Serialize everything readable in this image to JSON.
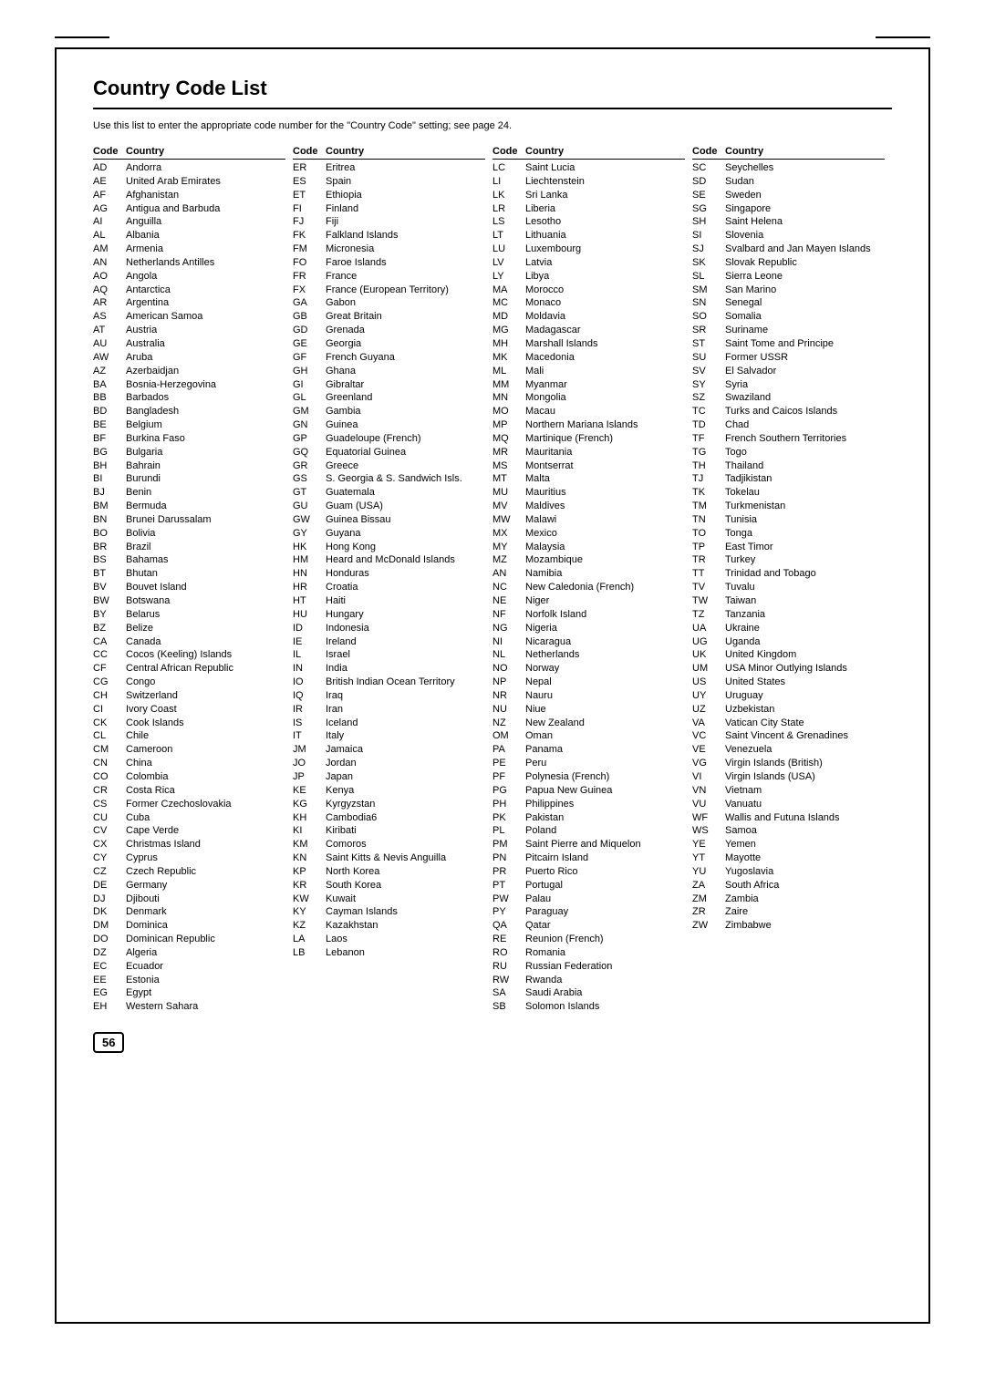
{
  "page": {
    "title": "Country Code List",
    "subtitle": "Use this list to enter the appropriate code number for the \"Country Code\" setting; see page 24.",
    "page_number": "56"
  },
  "columns": [
    {
      "header": {
        "code": "Code",
        "country": "Country"
      },
      "entries": [
        {
          "code": "AD",
          "country": "Andorra"
        },
        {
          "code": "AE",
          "country": "United Arab Emirates"
        },
        {
          "code": "AF",
          "country": "Afghanistan"
        },
        {
          "code": "AG",
          "country": "Antigua and Barbuda"
        },
        {
          "code": "AI",
          "country": "Anguilla"
        },
        {
          "code": "AL",
          "country": "Albania"
        },
        {
          "code": "AM",
          "country": "Armenia"
        },
        {
          "code": "AN",
          "country": "Netherlands Antilles"
        },
        {
          "code": "AO",
          "country": "Angola"
        },
        {
          "code": "AQ",
          "country": "Antarctica"
        },
        {
          "code": "AR",
          "country": "Argentina"
        },
        {
          "code": "AS",
          "country": "American Samoa"
        },
        {
          "code": "AT",
          "country": "Austria"
        },
        {
          "code": "AU",
          "country": "Australia"
        },
        {
          "code": "AW",
          "country": "Aruba"
        },
        {
          "code": "AZ",
          "country": "Azerbaidjan"
        },
        {
          "code": "BA",
          "country": "Bosnia-Herzegovina"
        },
        {
          "code": "BB",
          "country": "Barbados"
        },
        {
          "code": "BD",
          "country": "Bangladesh"
        },
        {
          "code": "BE",
          "country": "Belgium"
        },
        {
          "code": "BF",
          "country": "Burkina Faso"
        },
        {
          "code": "BG",
          "country": "Bulgaria"
        },
        {
          "code": "BH",
          "country": "Bahrain"
        },
        {
          "code": "BI",
          "country": "Burundi"
        },
        {
          "code": "BJ",
          "country": "Benin"
        },
        {
          "code": "BM",
          "country": "Bermuda"
        },
        {
          "code": "BN",
          "country": "Brunei Darussalam"
        },
        {
          "code": "BO",
          "country": "Bolivia"
        },
        {
          "code": "BR",
          "country": "Brazil"
        },
        {
          "code": "BS",
          "country": "Bahamas"
        },
        {
          "code": "BT",
          "country": "Bhutan"
        },
        {
          "code": "BV",
          "country": "Bouvet Island"
        },
        {
          "code": "BW",
          "country": "Botswana"
        },
        {
          "code": "BY",
          "country": "Belarus"
        },
        {
          "code": "BZ",
          "country": "Belize"
        },
        {
          "code": "CA",
          "country": "Canada"
        },
        {
          "code": "CC",
          "country": "Cocos (Keeling) Islands"
        },
        {
          "code": "CF",
          "country": "Central African Republic"
        },
        {
          "code": "CG",
          "country": "Congo"
        },
        {
          "code": "CH",
          "country": "Switzerland"
        },
        {
          "code": "CI",
          "country": "Ivory Coast"
        },
        {
          "code": "CK",
          "country": "Cook Islands"
        },
        {
          "code": "CL",
          "country": "Chile"
        },
        {
          "code": "CM",
          "country": "Cameroon"
        },
        {
          "code": "CN",
          "country": "China"
        },
        {
          "code": "CO",
          "country": "Colombia"
        },
        {
          "code": "CR",
          "country": "Costa Rica"
        },
        {
          "code": "CS",
          "country": "Former Czechoslovakia"
        },
        {
          "code": "CU",
          "country": "Cuba"
        },
        {
          "code": "CV",
          "country": "Cape Verde"
        },
        {
          "code": "CX",
          "country": "Christmas Island"
        },
        {
          "code": "CY",
          "country": "Cyprus"
        },
        {
          "code": "CZ",
          "country": "Czech Republic"
        },
        {
          "code": "DE",
          "country": "Germany"
        },
        {
          "code": "DJ",
          "country": "Djibouti"
        },
        {
          "code": "DK",
          "country": "Denmark"
        },
        {
          "code": "DM",
          "country": "Dominica"
        },
        {
          "code": "DO",
          "country": "Dominican Republic"
        },
        {
          "code": "DZ",
          "country": "Algeria"
        },
        {
          "code": "EC",
          "country": "Ecuador"
        },
        {
          "code": "EE",
          "country": "Estonia"
        },
        {
          "code": "EG",
          "country": "Egypt"
        },
        {
          "code": "EH",
          "country": "Western Sahara"
        }
      ]
    },
    {
      "header": {
        "code": "Code",
        "country": "Country"
      },
      "entries": [
        {
          "code": "ER",
          "country": "Eritrea"
        },
        {
          "code": "ES",
          "country": "Spain"
        },
        {
          "code": "ET",
          "country": "Ethiopia"
        },
        {
          "code": "FI",
          "country": "Finland"
        },
        {
          "code": "FJ",
          "country": "Fiji"
        },
        {
          "code": "FK",
          "country": "Falkland Islands"
        },
        {
          "code": "FM",
          "country": "Micronesia"
        },
        {
          "code": "FO",
          "country": "Faroe Islands"
        },
        {
          "code": "FR",
          "country": "France"
        },
        {
          "code": "FX",
          "country": "France (European Territory)"
        },
        {
          "code": "GA",
          "country": "Gabon"
        },
        {
          "code": "GB",
          "country": "Great Britain"
        },
        {
          "code": "GD",
          "country": "Grenada"
        },
        {
          "code": "GE",
          "country": "Georgia"
        },
        {
          "code": "GF",
          "country": "French Guyana"
        },
        {
          "code": "GH",
          "country": "Ghana"
        },
        {
          "code": "GI",
          "country": "Gibraltar"
        },
        {
          "code": "GL",
          "country": "Greenland"
        },
        {
          "code": "GM",
          "country": "Gambia"
        },
        {
          "code": "GN",
          "country": "Guinea"
        },
        {
          "code": "GP",
          "country": "Guadeloupe (French)"
        },
        {
          "code": "GQ",
          "country": "Equatorial Guinea"
        },
        {
          "code": "GR",
          "country": "Greece"
        },
        {
          "code": "GS",
          "country": "S. Georgia & S. Sandwich Isls."
        },
        {
          "code": "GT",
          "country": "Guatemala"
        },
        {
          "code": "GU",
          "country": "Guam (USA)"
        },
        {
          "code": "GW",
          "country": "Guinea Bissau"
        },
        {
          "code": "GY",
          "country": "Guyana"
        },
        {
          "code": "HK",
          "country": "Hong Kong"
        },
        {
          "code": "HM",
          "country": "Heard and McDonald Islands"
        },
        {
          "code": "HN",
          "country": "Honduras"
        },
        {
          "code": "HR",
          "country": "Croatia"
        },
        {
          "code": "HT",
          "country": "Haiti"
        },
        {
          "code": "HU",
          "country": "Hungary"
        },
        {
          "code": "ID",
          "country": "Indonesia"
        },
        {
          "code": "IE",
          "country": "Ireland"
        },
        {
          "code": "IL",
          "country": "Israel"
        },
        {
          "code": "IN",
          "country": "India"
        },
        {
          "code": "IO",
          "country": "British Indian Ocean Territory"
        },
        {
          "code": "IQ",
          "country": "Iraq"
        },
        {
          "code": "IR",
          "country": "Iran"
        },
        {
          "code": "IS",
          "country": "Iceland"
        },
        {
          "code": "IT",
          "country": "Italy"
        },
        {
          "code": "JM",
          "country": "Jamaica"
        },
        {
          "code": "JO",
          "country": "Jordan"
        },
        {
          "code": "JP",
          "country": "Japan"
        },
        {
          "code": "KE",
          "country": "Kenya"
        },
        {
          "code": "KG",
          "country": "Kyrgyzstan"
        },
        {
          "code": "KH",
          "country": "Cambodia6"
        },
        {
          "code": "KI",
          "country": "Kiribati"
        },
        {
          "code": "KM",
          "country": "Comoros"
        },
        {
          "code": "KN",
          "country": "Saint Kitts & Nevis Anguilla"
        },
        {
          "code": "KP",
          "country": "North Korea"
        },
        {
          "code": "KR",
          "country": "South Korea"
        },
        {
          "code": "KW",
          "country": "Kuwait"
        },
        {
          "code": "KY",
          "country": "Cayman Islands"
        },
        {
          "code": "KZ",
          "country": "Kazakhstan"
        },
        {
          "code": "LA",
          "country": "Laos"
        },
        {
          "code": "LB",
          "country": "Lebanon"
        }
      ]
    },
    {
      "header": {
        "code": "Code",
        "country": "Country"
      },
      "entries": [
        {
          "code": "LC",
          "country": "Saint Lucia"
        },
        {
          "code": "LI",
          "country": "Liechtenstein"
        },
        {
          "code": "LK",
          "country": "Sri Lanka"
        },
        {
          "code": "LR",
          "country": "Liberia"
        },
        {
          "code": "LS",
          "country": "Lesotho"
        },
        {
          "code": "LT",
          "country": "Lithuania"
        },
        {
          "code": "LU",
          "country": "Luxembourg"
        },
        {
          "code": "LV",
          "country": "Latvia"
        },
        {
          "code": "LY",
          "country": "Libya"
        },
        {
          "code": "MA",
          "country": "Morocco"
        },
        {
          "code": "MC",
          "country": "Monaco"
        },
        {
          "code": "MD",
          "country": "Moldavia"
        },
        {
          "code": "MG",
          "country": "Madagascar"
        },
        {
          "code": "MH",
          "country": "Marshall Islands"
        },
        {
          "code": "MK",
          "country": "Macedonia"
        },
        {
          "code": "ML",
          "country": "Mali"
        },
        {
          "code": "MM",
          "country": "Myanmar"
        },
        {
          "code": "MN",
          "country": "Mongolia"
        },
        {
          "code": "MO",
          "country": "Macau"
        },
        {
          "code": "MP",
          "country": "Northern Mariana Islands"
        },
        {
          "code": "MQ",
          "country": "Martinique (French)"
        },
        {
          "code": "MR",
          "country": "Mauritania"
        },
        {
          "code": "MS",
          "country": "Montserrat"
        },
        {
          "code": "MT",
          "country": "Malta"
        },
        {
          "code": "MU",
          "country": "Mauritius"
        },
        {
          "code": "MV",
          "country": "Maldives"
        },
        {
          "code": "MW",
          "country": "Malawi"
        },
        {
          "code": "MX",
          "country": "Mexico"
        },
        {
          "code": "MY",
          "country": "Malaysia"
        },
        {
          "code": "MZ",
          "country": "Mozambique"
        },
        {
          "code": "AN",
          "country": "Namibia"
        },
        {
          "code": "NC",
          "country": "New Caledonia (French)"
        },
        {
          "code": "NE",
          "country": "Niger"
        },
        {
          "code": "NF",
          "country": "Norfolk Island"
        },
        {
          "code": "NG",
          "country": "Nigeria"
        },
        {
          "code": "NI",
          "country": "Nicaragua"
        },
        {
          "code": "NL",
          "country": "Netherlands"
        },
        {
          "code": "NO",
          "country": "Norway"
        },
        {
          "code": "NP",
          "country": "Nepal"
        },
        {
          "code": "NR",
          "country": "Nauru"
        },
        {
          "code": "NU",
          "country": "Niue"
        },
        {
          "code": "NZ",
          "country": "New Zealand"
        },
        {
          "code": "OM",
          "country": "Oman"
        },
        {
          "code": "PA",
          "country": "Panama"
        },
        {
          "code": "PE",
          "country": "Peru"
        },
        {
          "code": "PF",
          "country": "Polynesia (French)"
        },
        {
          "code": "PG",
          "country": "Papua New Guinea"
        },
        {
          "code": "PH",
          "country": "Philippines"
        },
        {
          "code": "PK",
          "country": "Pakistan"
        },
        {
          "code": "PL",
          "country": "Poland"
        },
        {
          "code": "PM",
          "country": "Saint Pierre and Miquelon"
        },
        {
          "code": "PN",
          "country": "Pitcairn Island"
        },
        {
          "code": "PR",
          "country": "Puerto Rico"
        },
        {
          "code": "PT",
          "country": "Portugal"
        },
        {
          "code": "PW",
          "country": "Palau"
        },
        {
          "code": "PY",
          "country": "Paraguay"
        },
        {
          "code": "QA",
          "country": "Qatar"
        },
        {
          "code": "RE",
          "country": "Reunion (French)"
        },
        {
          "code": "RO",
          "country": "Romania"
        },
        {
          "code": "RU",
          "country": "Russian Federation"
        },
        {
          "code": "RW",
          "country": "Rwanda"
        },
        {
          "code": "SA",
          "country": "Saudi Arabia"
        },
        {
          "code": "SB",
          "country": "Solomon Islands"
        }
      ]
    },
    {
      "header": {
        "code": "Code",
        "country": "Country"
      },
      "entries": [
        {
          "code": "SC",
          "country": "Seychelles"
        },
        {
          "code": "SD",
          "country": "Sudan"
        },
        {
          "code": "SE",
          "country": "Sweden"
        },
        {
          "code": "SG",
          "country": "Singapore"
        },
        {
          "code": "SH",
          "country": "Saint Helena"
        },
        {
          "code": "SI",
          "country": "Slovenia"
        },
        {
          "code": "SJ",
          "country": "Svalbard and Jan Mayen Islands"
        },
        {
          "code": "SK",
          "country": "Slovak Republic"
        },
        {
          "code": "SL",
          "country": "Sierra Leone"
        },
        {
          "code": "SM",
          "country": "San Marino"
        },
        {
          "code": "SN",
          "country": "Senegal"
        },
        {
          "code": "SO",
          "country": "Somalia"
        },
        {
          "code": "SR",
          "country": "Suriname"
        },
        {
          "code": "ST",
          "country": "Saint Tome and Principe"
        },
        {
          "code": "SU",
          "country": "Former USSR"
        },
        {
          "code": "SV",
          "country": "El Salvador"
        },
        {
          "code": "SY",
          "country": "Syria"
        },
        {
          "code": "SZ",
          "country": "Swaziland"
        },
        {
          "code": "TC",
          "country": "Turks and Caicos Islands"
        },
        {
          "code": "TD",
          "country": "Chad"
        },
        {
          "code": "TF",
          "country": "French Southern Territories"
        },
        {
          "code": "TG",
          "country": "Togo"
        },
        {
          "code": "TH",
          "country": "Thailand"
        },
        {
          "code": "TJ",
          "country": "Tadjikistan"
        },
        {
          "code": "TK",
          "country": "Tokelau"
        },
        {
          "code": "TM",
          "country": "Turkmenistan"
        },
        {
          "code": "TN",
          "country": "Tunisia"
        },
        {
          "code": "TO",
          "country": "Tonga"
        },
        {
          "code": "TP",
          "country": "East Timor"
        },
        {
          "code": "TR",
          "country": "Turkey"
        },
        {
          "code": "TT",
          "country": "Trinidad and Tobago"
        },
        {
          "code": "TV",
          "country": "Tuvalu"
        },
        {
          "code": "TW",
          "country": "Taiwan"
        },
        {
          "code": "TZ",
          "country": "Tanzania"
        },
        {
          "code": "UA",
          "country": "Ukraine"
        },
        {
          "code": "UG",
          "country": "Uganda"
        },
        {
          "code": "UK",
          "country": "United Kingdom"
        },
        {
          "code": "UM",
          "country": "USA Minor Outlying Islands"
        },
        {
          "code": "US",
          "country": "United States"
        },
        {
          "code": "UY",
          "country": "Uruguay"
        },
        {
          "code": "UZ",
          "country": "Uzbekistan"
        },
        {
          "code": "VA",
          "country": "Vatican City State"
        },
        {
          "code": "VC",
          "country": "Saint Vincent & Grenadines"
        },
        {
          "code": "VE",
          "country": "Venezuela"
        },
        {
          "code": "VG",
          "country": "Virgin Islands (British)"
        },
        {
          "code": "VI",
          "country": "Virgin Islands (USA)"
        },
        {
          "code": "VN",
          "country": "Vietnam"
        },
        {
          "code": "VU",
          "country": "Vanuatu"
        },
        {
          "code": "WF",
          "country": "Wallis and Futuna Islands"
        },
        {
          "code": "WS",
          "country": "Samoa"
        },
        {
          "code": "YE",
          "country": "Yemen"
        },
        {
          "code": "YT",
          "country": "Mayotte"
        },
        {
          "code": "YU",
          "country": "Yugoslavia"
        },
        {
          "code": "ZA",
          "country": "South Africa"
        },
        {
          "code": "ZM",
          "country": "Zambia"
        },
        {
          "code": "ZR",
          "country": "Zaire"
        },
        {
          "code": "ZW",
          "country": "Zimbabwe"
        }
      ]
    }
  ]
}
